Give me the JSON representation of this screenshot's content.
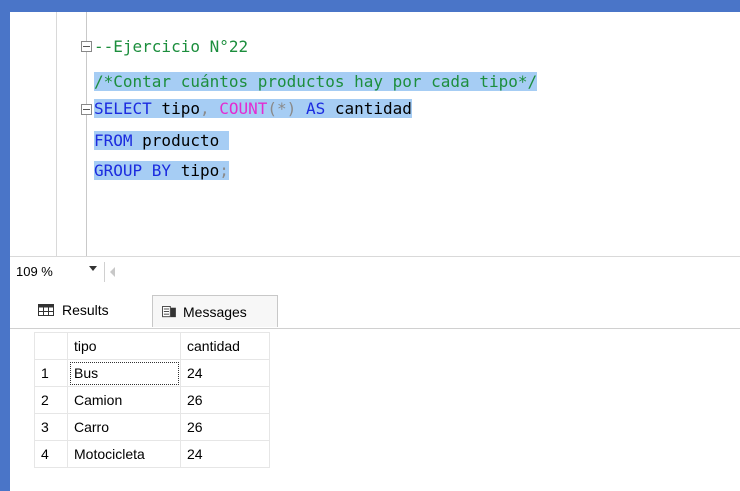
{
  "editor": {
    "lines": [
      {
        "parts": [
          {
            "t": "--Ejercicio N°22",
            "c": "cm"
          }
        ]
      },
      {
        "parts": [
          {
            "t": "/*Contar cuántos productos hay por cada tipo*/",
            "c": "cm"
          }
        ]
      },
      {
        "parts": [
          {
            "t": "SELECT",
            "c": "kw"
          },
          {
            "t": " tipo",
            "c": ""
          },
          {
            "t": ",",
            "c": "op"
          },
          {
            "t": " COUNT",
            "c": "fn"
          },
          {
            "t": "(*)",
            "c": "op"
          },
          {
            "t": " AS",
            "c": "kw"
          },
          {
            "t": " cantidad",
            "c": ""
          }
        ]
      },
      {
        "parts": [
          {
            "t": "FROM",
            "c": "kw"
          },
          {
            "t": " producto",
            "c": ""
          }
        ]
      },
      {
        "parts": [
          {
            "t": "GROUP BY",
            "c": "kw"
          },
          {
            "t": " tipo",
            "c": ""
          },
          {
            "t": ";",
            "c": "op"
          }
        ]
      }
    ]
  },
  "zoom": {
    "level": "109 %"
  },
  "tabs": {
    "results": "Results",
    "messages": "Messages"
  },
  "grid": {
    "columns": [
      "tipo",
      "cantidad"
    ],
    "rows": [
      {
        "num": "1",
        "tipo": "Bus",
        "cantidad": "24"
      },
      {
        "num": "2",
        "tipo": "Camion",
        "cantidad": "26"
      },
      {
        "num": "3",
        "tipo": "Carro",
        "cantidad": "26"
      },
      {
        "num": "4",
        "tipo": "Motocicleta",
        "cantidad": "24"
      }
    ]
  }
}
